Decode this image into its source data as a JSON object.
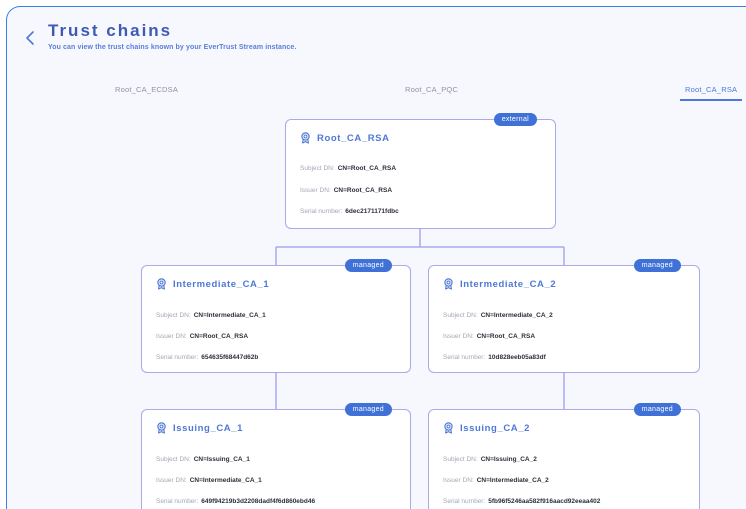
{
  "header": {
    "title": "Trust chains",
    "subtitle": "You can view the trust chains known by your EverTrust Stream instance."
  },
  "tabs": [
    {
      "label": "Root_CA_ECDSA"
    },
    {
      "label": "Root_CA_PQC"
    },
    {
      "label": "Root_CA_RSA",
      "active": true
    }
  ],
  "labels": {
    "subject": "Subject DN:",
    "issuer": "Issuer DN:",
    "serial": "Serial number:"
  },
  "nodes": {
    "root": {
      "name": "Root_CA_RSA",
      "badge": "external",
      "subject": "CN=Root_CA_RSA",
      "issuer": "CN=Root_CA_RSA",
      "serial": "6dec2171171fdbc"
    },
    "int1": {
      "name": "Intermediate_CA_1",
      "badge": "managed",
      "subject": "CN=Intermediate_CA_1",
      "issuer": "CN=Root_CA_RSA",
      "serial": "654635f68447d62b"
    },
    "int2": {
      "name": "Intermediate_CA_2",
      "badge": "managed",
      "subject": "CN=Intermediate_CA_2",
      "issuer": "CN=Root_CA_RSA",
      "serial": "10d828eeb05a83df"
    },
    "iss1": {
      "name": "Issuing_CA_1",
      "badge": "managed",
      "subject": "CN=Issuing_CA_1",
      "issuer": "CN=Intermediate_CA_1",
      "serial": "649f94219b3d2208dadf4f6d860ebd46"
    },
    "iss2": {
      "name": "Issuing_CA_2",
      "badge": "managed",
      "subject": "CN=Issuing_CA_2",
      "issuer": "CN=Intermediate_CA_2",
      "serial": "5fb96f5246aa582f916aacd92eeaa402"
    }
  },
  "colors": {
    "accent": "#3f71d6",
    "card_border": "#a9a9ec",
    "title": "#3e5ab5",
    "frame_border": "#3b7ee6"
  },
  "icons": {
    "back": "chevron-left-icon",
    "certificate": "certificate-badge-icon"
  }
}
